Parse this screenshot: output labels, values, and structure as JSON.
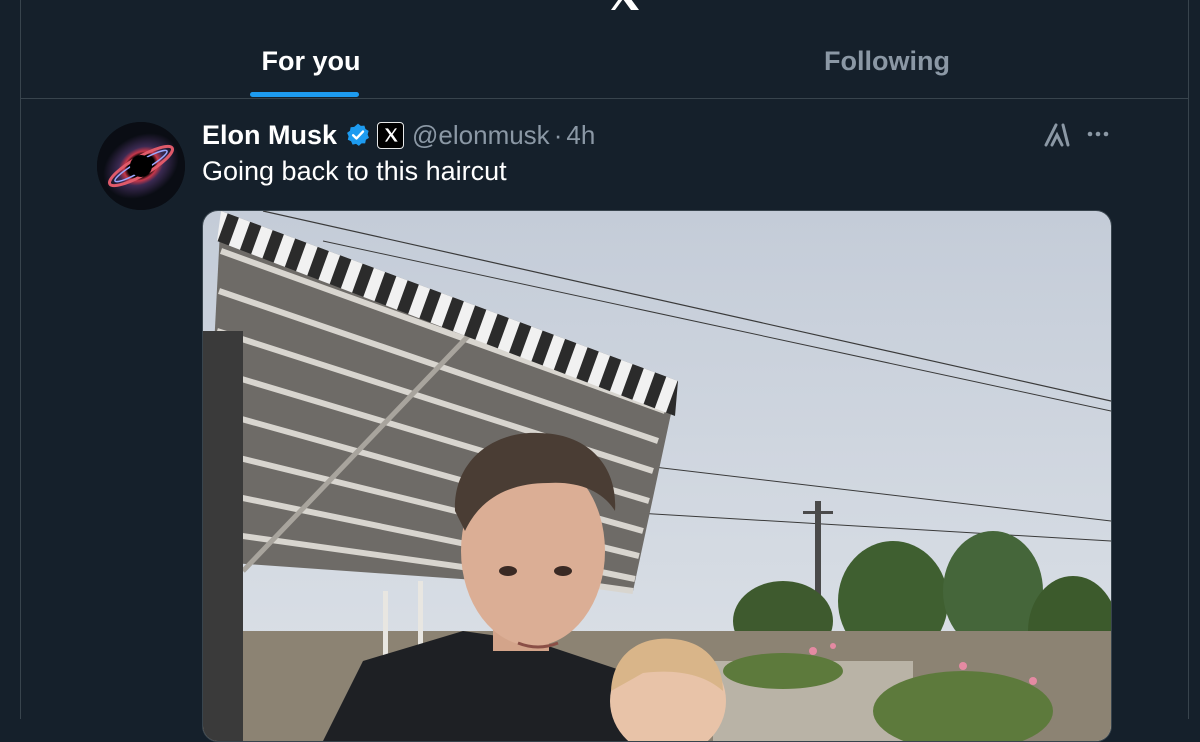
{
  "tabs": [
    {
      "label": "For you",
      "active": true
    },
    {
      "label": "Following",
      "active": false
    }
  ],
  "tweet": {
    "author_name": "Elon Musk",
    "handle": "@elonmusk",
    "separator": "·",
    "time": "4h",
    "text": "Going back to this haircut",
    "verified": true,
    "affiliate_badge": "x-logo-icon"
  },
  "icons": {
    "app_logo": "x-logo-icon",
    "grok": "grok-icon",
    "more": "more-horizontal-icon",
    "verified": "verified-badge-icon"
  },
  "colors": {
    "background": "#15202b",
    "accent": "#1d9bf0",
    "text_primary": "#e7e9ea",
    "text_secondary": "#8b98a5",
    "border": "#38444d"
  }
}
